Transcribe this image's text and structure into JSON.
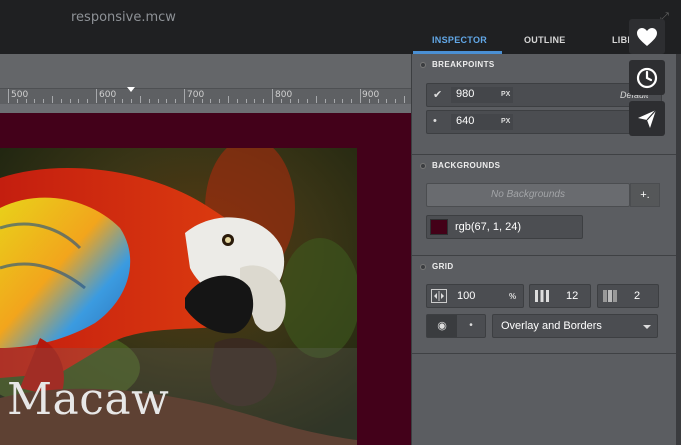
{
  "window": {
    "title": "responsive.mcw"
  },
  "tabs": [
    {
      "label": "INSPECTOR"
    },
    {
      "label": "OUTLINE"
    },
    {
      "label": "LIBRARY"
    }
  ],
  "ruler": {
    "ticks": [
      "500",
      "600",
      "700",
      "800",
      "900"
    ]
  },
  "canvas": {
    "photo_caption": "Macaw"
  },
  "breakpoints": {
    "header": "BREAKPOINTS",
    "items": [
      {
        "value": "980",
        "unit": "PX",
        "note": "Default"
      },
      {
        "value": "640",
        "unit": "PX",
        "note": ""
      }
    ]
  },
  "backgrounds": {
    "header": "BACKGROUNDS",
    "empty_label": "No Backgrounds",
    "add_label": "+.",
    "item_label": "rgb(67, 1, 24)",
    "swatch_color": "#430118"
  },
  "grid": {
    "header": "GRID",
    "width_value": "100",
    "width_unit": "%",
    "columns_value": "12",
    "gutter_value": "2",
    "display_mode": "Overlay and Borders"
  },
  "colors": {
    "accent": "#4a8fd3",
    "stage": "#43011a"
  },
  "icons": {
    "favorite": "heart-icon",
    "history": "clock-icon",
    "share": "paper-plane-icon"
  }
}
